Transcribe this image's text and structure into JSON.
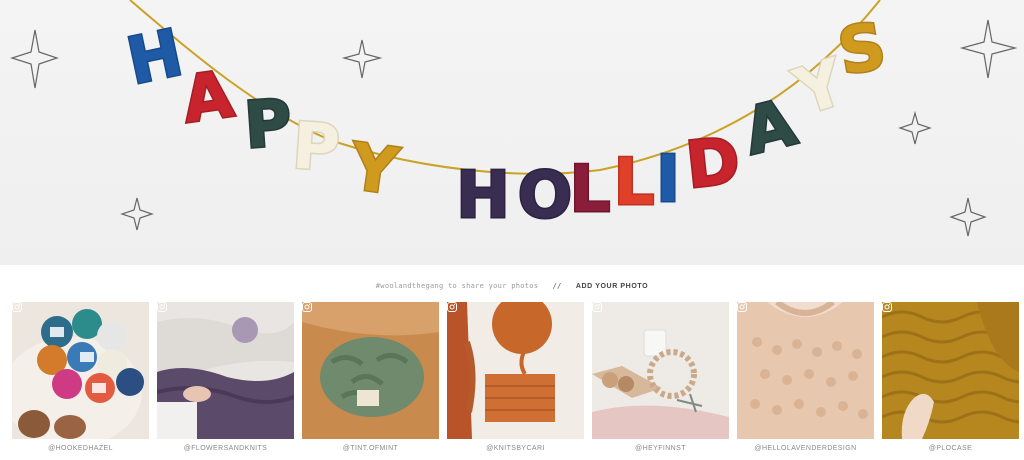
{
  "hero": {
    "banner_word_1": [
      "H",
      "A",
      "P",
      "P",
      "Y"
    ],
    "banner_word_2": [
      "H",
      "O",
      "L",
      "I",
      "D",
      "A",
      "Y",
      "S"
    ],
    "colors": {
      "blue": "#1f5aa6",
      "red": "#c8242d",
      "green": "#2f4b46",
      "cream": "#f5f0df",
      "mustard": "#d09a1f",
      "navy": "#3a2d52",
      "burgundy": "#8a1e3a",
      "orange_red": "#e0402a",
      "string": "#c9a227"
    },
    "decor_icons": [
      "sparkle-icon",
      "sparkle-icon",
      "sparkle-icon",
      "sparkle-icon",
      "sparkle-icon",
      "sparkle-icon"
    ]
  },
  "share": {
    "hashtag_text": "#woolandthegang to share your photos",
    "separator": "//",
    "add_photo_label": "ADD YOUR PHOTO"
  },
  "gallery": {
    "items": [
      {
        "handle": "@HOOKEDHAZEL",
        "icon": "instagram-icon"
      },
      {
        "handle": "@FLOWERSANDKNITS",
        "icon": "instagram-icon"
      },
      {
        "handle": "@TINT.OFMINT",
        "icon": "instagram-icon"
      },
      {
        "handle": "@KNITSBYCARI",
        "icon": "instagram-icon"
      },
      {
        "handle": "@HEYFINNST",
        "icon": "instagram-icon"
      },
      {
        "handle": "@HELLOLAVENDERDESIGN",
        "icon": "instagram-icon"
      },
      {
        "handle": "@PLOCASE",
        "icon": "instagram-icon"
      }
    ]
  }
}
